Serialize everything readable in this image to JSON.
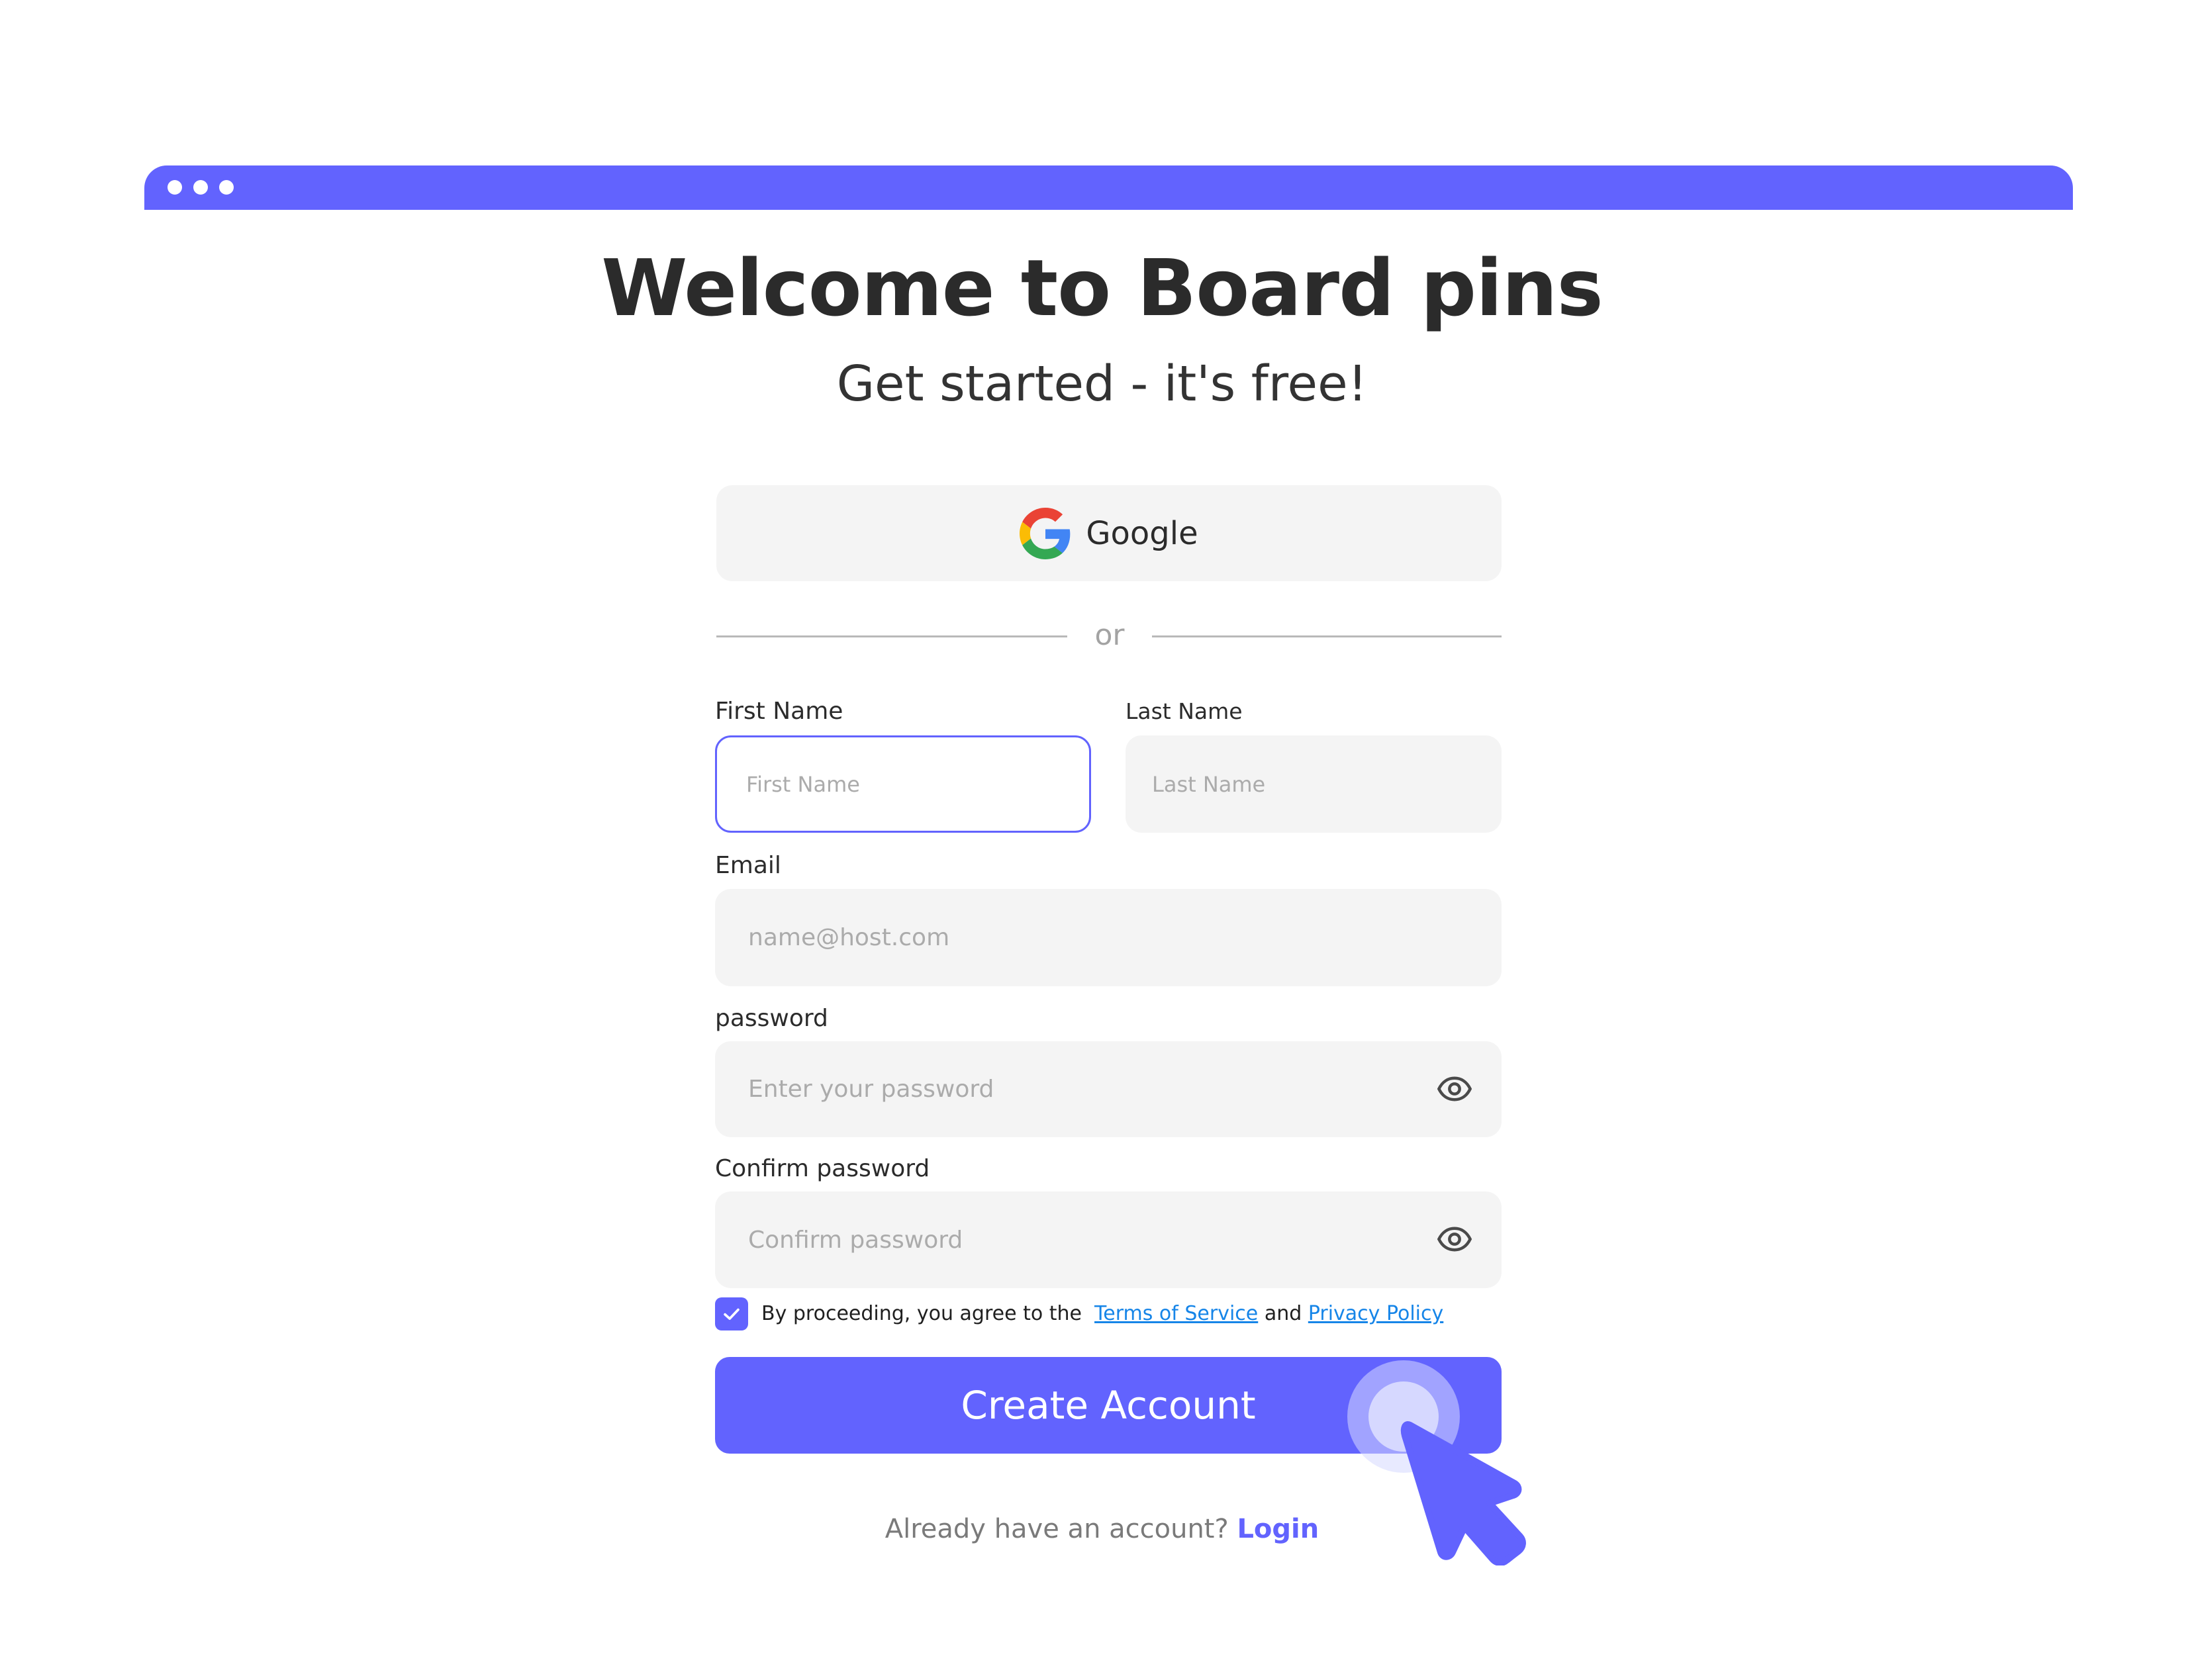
{
  "window": {
    "accent_color": "#6263fe",
    "window_controls": [
      "dot",
      "dot",
      "dot"
    ]
  },
  "header": {
    "title": "Welcome to Board pins",
    "subtitle": "Get started - it's free!"
  },
  "social": {
    "google_label": "Google",
    "divider_text": "or"
  },
  "form": {
    "first_name": {
      "label": "First Name",
      "placeholder": "First Name",
      "value": ""
    },
    "last_name": {
      "label": "Last Name",
      "placeholder": "Last Name",
      "value": ""
    },
    "email": {
      "label": "Email",
      "placeholder": "name@host.com",
      "value": ""
    },
    "password": {
      "label": "password",
      "placeholder": "Enter your password",
      "value": "",
      "icon": "eye-icon"
    },
    "confirm_password": {
      "label": "Confirm password",
      "placeholder": "Confirm password",
      "value": "",
      "icon": "eye-icon"
    },
    "agreement": {
      "checked": true,
      "prefix": "By proceeding, you agree to the",
      "terms_link": "Terms of Service",
      "conjunction": "and",
      "privacy_link": "Privacy Policy"
    },
    "submit_label": "Create Account"
  },
  "footer": {
    "prompt": "Already have an account?",
    "login_link": "Login"
  }
}
